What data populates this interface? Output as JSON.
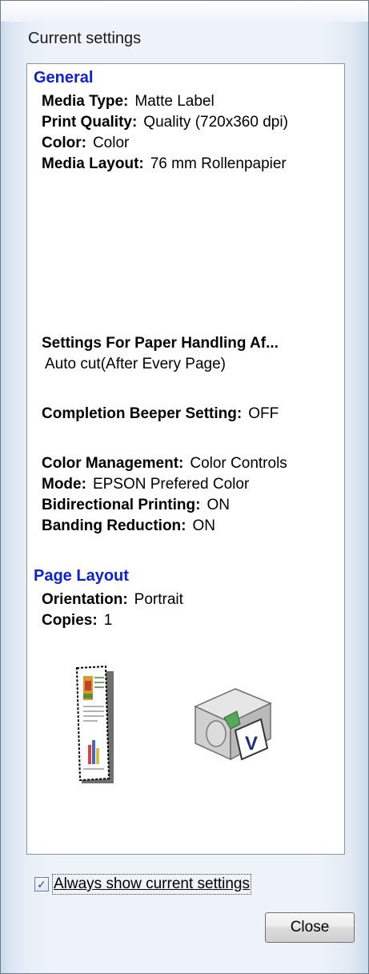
{
  "window": {
    "title": "Current settings"
  },
  "general": {
    "heading": "General",
    "media_type": {
      "key": "Media Type:",
      "value": "Matte Label"
    },
    "print_quality": {
      "key": "Print Quality:",
      "value": "Quality (720x360 dpi)"
    },
    "color": {
      "key": "Color:",
      "value": "Color"
    },
    "media_layout": {
      "key": "Media Layout:",
      "value": "76 mm Rollenpapier"
    },
    "paper_handling": {
      "key": "Settings For Paper Handling Af...",
      "value": "Auto cut(After Every Page)"
    },
    "beeper": {
      "key": "Completion Beeper Setting:",
      "value": "OFF"
    },
    "color_management": {
      "key": "Color Management:",
      "value": "Color Controls"
    },
    "mode": {
      "key": "Mode:",
      "value": "EPSON Prefered Color"
    },
    "bidirectional": {
      "key": "Bidirectional Printing:",
      "value": "ON"
    },
    "banding": {
      "key": "Banding Reduction:",
      "value": "ON"
    }
  },
  "page_layout": {
    "heading": "Page Layout",
    "orientation": {
      "key": "Orientation:",
      "value": "Portrait"
    },
    "copies": {
      "key": "Copies:",
      "value": "1"
    }
  },
  "footer": {
    "always_show_label": "Always show current settings",
    "always_show_checked": true,
    "close_label": "Close"
  },
  "icons": {
    "paper_preview": "paper-roll-preview-icon",
    "printer": "printer-icon"
  }
}
